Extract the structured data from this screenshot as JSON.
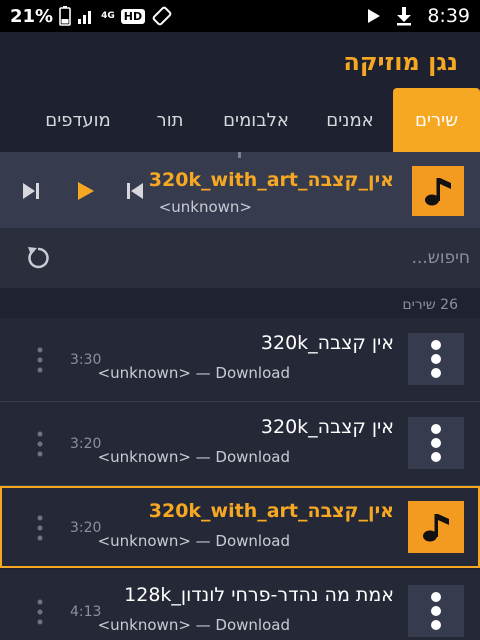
{
  "status": {
    "battery_pct": "21%",
    "network": "4G",
    "hd_badge": "HD",
    "time": "8:39"
  },
  "header": {
    "title": "נגן מוזיקה"
  },
  "tabs": [
    {
      "label": "שירים",
      "active": true
    },
    {
      "label": "אמנים",
      "active": false
    },
    {
      "label": "אלבומים",
      "active": false
    },
    {
      "label": "תור",
      "active": false
    },
    {
      "label": "מועדפים",
      "active": false
    }
  ],
  "player": {
    "title": "אין_קצבה_320k_with_art",
    "artist": "<unknown>"
  },
  "search": {
    "placeholder": "חיפוש..."
  },
  "list": {
    "count_label": "26 שירים",
    "items": [
      {
        "title": "אין קצבה_320k",
        "subtitle": "<unknown> — Download",
        "duration": "3:30",
        "current": false
      },
      {
        "title": "אין קצבה_320k",
        "subtitle": "<unknown> — Download",
        "duration": "3:20",
        "current": false
      },
      {
        "title": "אין_קצבה_320k_with_art",
        "subtitle": "<unknown> — Download",
        "duration": "3:20",
        "current": true
      },
      {
        "title": "אמת מה נהדר-פרחי לונדון_128k",
        "subtitle": "<unknown> — Download",
        "duration": "4:13",
        "current": false
      }
    ]
  },
  "colors": {
    "accent": "#f7a823",
    "background": "#1f2230",
    "player_bg": "#363b4e"
  }
}
